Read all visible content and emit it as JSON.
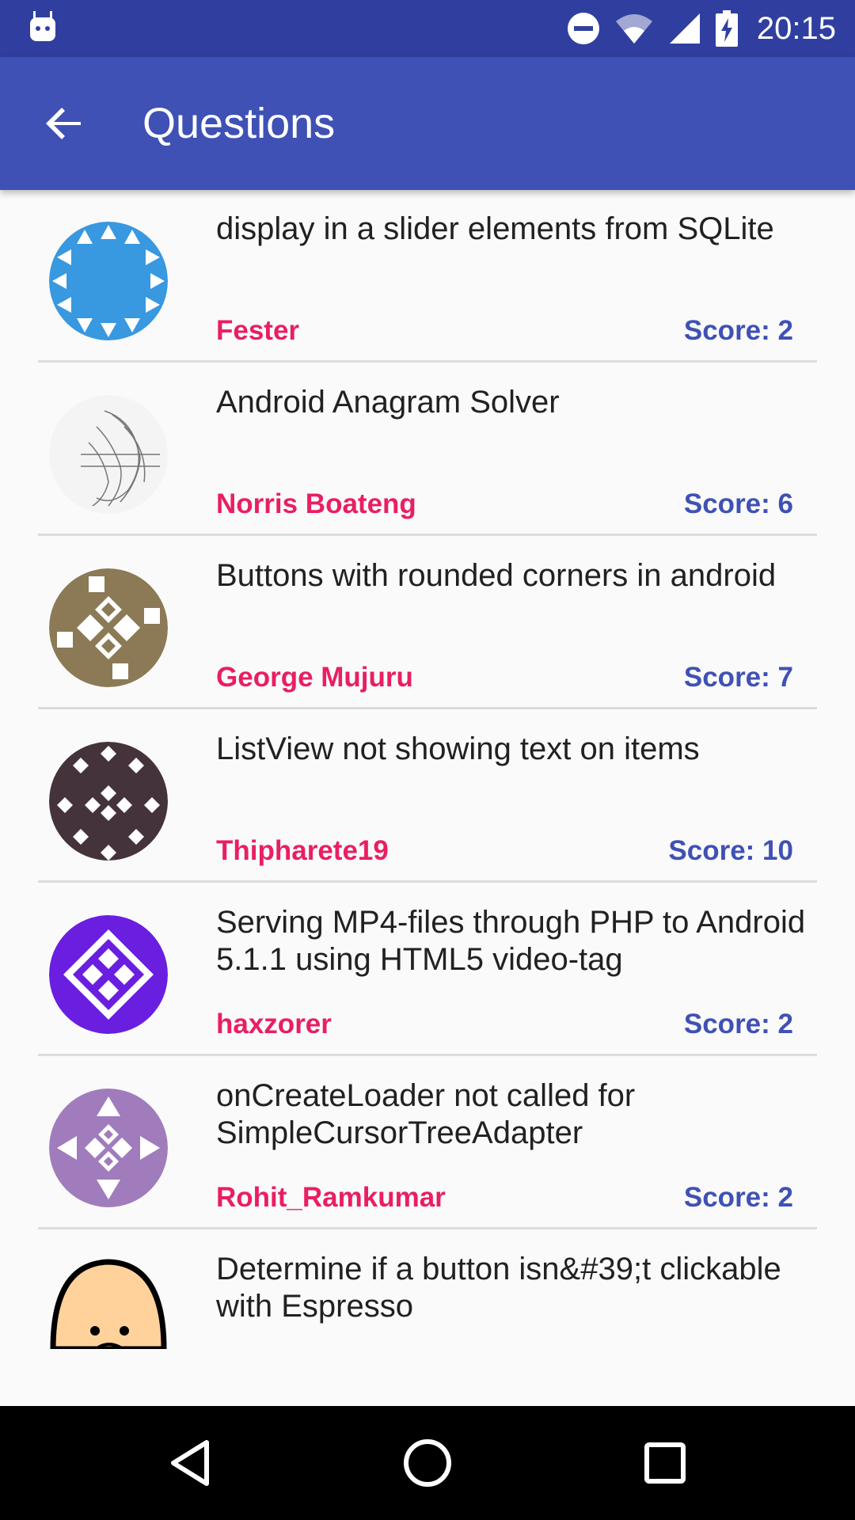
{
  "status_bar": {
    "time": "20:15",
    "icons": [
      "android-icon",
      "do-not-disturb-icon",
      "wifi-icon",
      "cell-signal-icon",
      "battery-charging-icon"
    ]
  },
  "app_bar": {
    "title": "Questions",
    "back_icon": "arrow-back-icon"
  },
  "questions": [
    {
      "title": "display in a slider elements from SQLite",
      "owner": "Fester",
      "score": "Score: 2",
      "avatar_color": "#3898e0"
    },
    {
      "title": "Android Anagram Solver",
      "owner": "Norris Boateng",
      "score": "Score: 6",
      "avatar_color": "#888888"
    },
    {
      "title": "Buttons with rounded corners in android",
      "owner": "George Mujuru",
      "score": "Score: 7",
      "avatar_color": "#8b7a55"
    },
    {
      "title": "ListView not showing text on items",
      "owner": "Thipharete19",
      "score": "Score: 10",
      "avatar_color": "#45333c"
    },
    {
      "title": "Serving MP4-files through PHP to Android 5.1.1 using HTML5 video-tag",
      "owner": "haxzorer",
      "score": "Score: 2",
      "avatar_color": "#6a1ee0"
    },
    {
      "title": "onCreateLoader not called for SimpleCursorTreeAdapter",
      "owner": "Rohit_Ramkumar",
      "score": "Score: 2",
      "avatar_color": "#a07cbd"
    },
    {
      "title": "Determine if a button isn&#39;t clickable with Espresso",
      "owner": "",
      "score": "",
      "avatar_color": "#ffd29c"
    }
  ],
  "nav_bar": {
    "icons": [
      "back-triangle-icon",
      "home-circle-icon",
      "recents-square-icon"
    ]
  },
  "colors": {
    "status_bar": "#303f9f",
    "app_bar": "#3f51b5",
    "owner": "#e91e63",
    "score": "#3f51b5"
  }
}
